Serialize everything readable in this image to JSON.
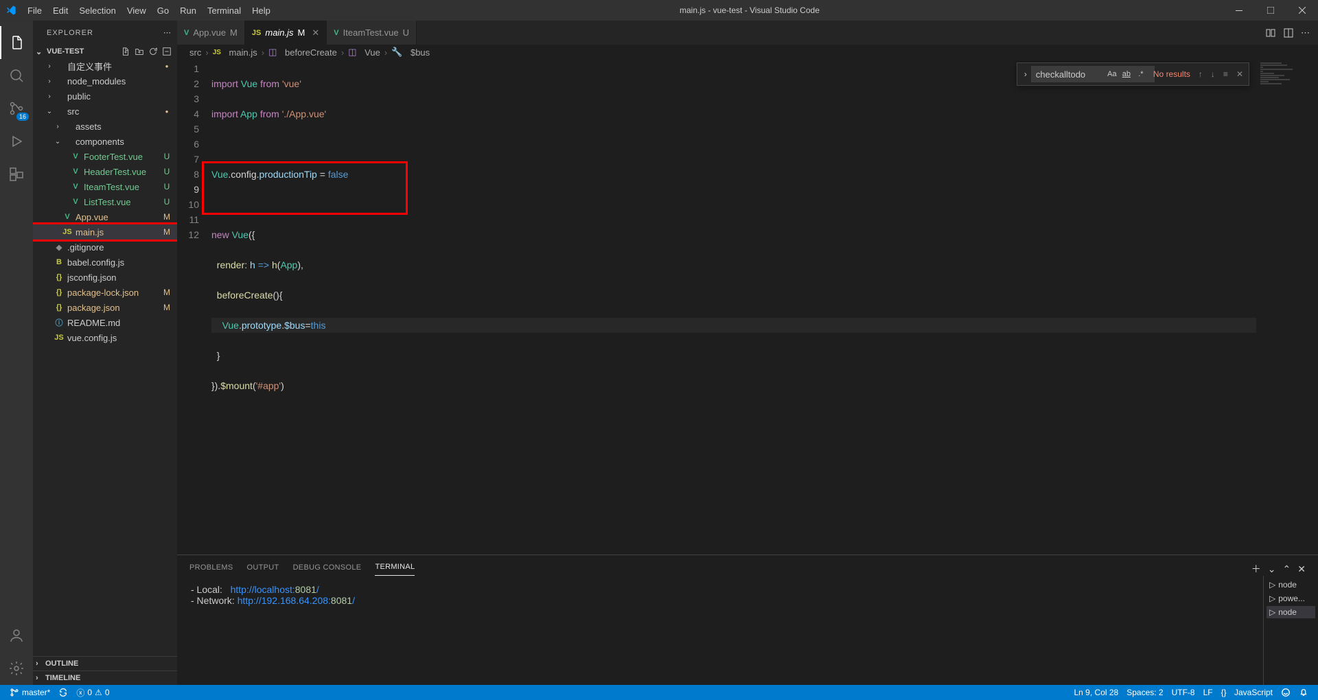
{
  "window": {
    "title": "main.js - vue-test - Visual Studio Code"
  },
  "menu": [
    "File",
    "Edit",
    "Selection",
    "View",
    "Go",
    "Run",
    "Terminal",
    "Help"
  ],
  "activitybar": {
    "badge": "16"
  },
  "sidebar": {
    "title": "EXPLORER",
    "folder": "VUE-TEST",
    "outline": "OUTLINE",
    "timeline": "TIMELINE"
  },
  "tree": [
    {
      "name": "自定义事件",
      "type": "folder",
      "indent": 1,
      "open": false,
      "status": "",
      "dot": true
    },
    {
      "name": "node_modules",
      "type": "folder",
      "indent": 1,
      "open": false
    },
    {
      "name": "public",
      "type": "folder",
      "indent": 1,
      "open": false
    },
    {
      "name": "src",
      "type": "folder",
      "indent": 1,
      "open": true,
      "status": "",
      "dot": true
    },
    {
      "name": "assets",
      "type": "folder",
      "indent": 2,
      "open": false
    },
    {
      "name": "components",
      "type": "folder",
      "indent": 2,
      "open": true
    },
    {
      "name": "FooterTest.vue",
      "type": "file",
      "icon": "V",
      "iconColor": "#41b883",
      "indent": 3,
      "status": "U",
      "statusClass": "U",
      "class": "untracked"
    },
    {
      "name": "HeaderTest.vue",
      "type": "file",
      "icon": "V",
      "iconColor": "#41b883",
      "indent": 3,
      "status": "U",
      "statusClass": "U",
      "class": "untracked"
    },
    {
      "name": "IteamTest.vue",
      "type": "file",
      "icon": "V",
      "iconColor": "#41b883",
      "indent": 3,
      "status": "U",
      "statusClass": "U",
      "class": "untracked"
    },
    {
      "name": "ListTest.vue",
      "type": "file",
      "icon": "V",
      "iconColor": "#41b883",
      "indent": 3,
      "status": "U",
      "statusClass": "U",
      "class": "untracked"
    },
    {
      "name": "App.vue",
      "type": "file",
      "icon": "V",
      "iconColor": "#41b883",
      "indent": 2,
      "status": "M",
      "statusClass": "M",
      "class": "modified"
    },
    {
      "name": "main.js",
      "type": "file",
      "icon": "JS",
      "iconColor": "#cbcb41",
      "indent": 2,
      "status": "M",
      "statusClass": "M",
      "class": "modified selected red-box"
    },
    {
      "name": ".gitignore",
      "type": "file",
      "icon": "◆",
      "iconColor": "#8d8d8d",
      "indent": 1
    },
    {
      "name": "babel.config.js",
      "type": "file",
      "icon": "B",
      "iconColor": "#cbcb41",
      "indent": 1
    },
    {
      "name": "jsconfig.json",
      "type": "file",
      "icon": "{}",
      "iconColor": "#cbcb41",
      "indent": 1
    },
    {
      "name": "package-lock.json",
      "type": "file",
      "icon": "{}",
      "iconColor": "#cbcb41",
      "indent": 1,
      "status": "M",
      "statusClass": "M",
      "class": "modified"
    },
    {
      "name": "package.json",
      "type": "file",
      "icon": "{}",
      "iconColor": "#cbcb41",
      "indent": 1,
      "status": "M",
      "statusClass": "M",
      "class": "modified"
    },
    {
      "name": "README.md",
      "type": "file",
      "icon": "ⓘ",
      "iconColor": "#519aba",
      "indent": 1
    },
    {
      "name": "vue.config.js",
      "type": "file",
      "icon": "JS",
      "iconColor": "#cbcb41",
      "indent": 1
    }
  ],
  "tabs": [
    {
      "name": "App.vue",
      "icon": "V",
      "iconColor": "#41b883",
      "status": "M",
      "statusClass": "M",
      "active": false
    },
    {
      "name": "main.js",
      "icon": "JS",
      "iconColor": "#cbcb41",
      "status": "M",
      "statusClass": "M",
      "active": true,
      "closeable": true,
      "italic": true
    },
    {
      "name": "IteamTest.vue",
      "icon": "V",
      "iconColor": "#41b883",
      "status": "U",
      "statusClass": "U",
      "active": false
    }
  ],
  "breadcrumbs": [
    {
      "label": "src"
    },
    {
      "icon": "JS",
      "label": "main.js"
    },
    {
      "icon": "cube",
      "label": "beforeCreate"
    },
    {
      "icon": "cube",
      "label": "Vue"
    },
    {
      "icon": "wrench",
      "label": "$bus"
    }
  ],
  "find": {
    "value": "checkalltodo",
    "result": "No results"
  },
  "code": {
    "lines": [
      1,
      2,
      3,
      4,
      5,
      6,
      7,
      8,
      9,
      10,
      11,
      12
    ]
  },
  "code_text": {
    "l1_import": "import",
    "l1_vue": "Vue",
    "l1_from": "from",
    "l1_str": "'vue'",
    "l2_import": "import",
    "l2_app": "App",
    "l2_from": "from",
    "l2_str": "'./App.vue'",
    "l4_a": "Vue",
    "l4_b": ".config.",
    "l4_c": "productionTip",
    "l4_eq": " = ",
    "l4_false": "false",
    "l6_new": "new",
    "l6_vue": "Vue",
    "l6_open": "({",
    "l7_render": "render",
    "l7_arrow": ": ",
    "l7_h1": "h",
    "l7_a2": " => ",
    "l7_h2": "h",
    "l7_p": "(",
    "l7_app": "App",
    "l7_close": "),",
    "l8_name": "beforeCreate",
    "l8_p": "(){",
    "l9_vue": "Vue",
    "l9_dot1": ".",
    "l9_proto": "prototype",
    "l9_dot2": ".",
    "l9_bus": "$bus",
    "l9_eq": "=",
    "l9_this": "this",
    "l10_close": "}",
    "l11_a": "}).",
    "l11_mount": "$mount",
    "l11_p": "(",
    "l11_str": "'#app'",
    "l11_cp": ")"
  },
  "panel": {
    "tabs": [
      "PROBLEMS",
      "OUTPUT",
      "DEBUG CONSOLE",
      "TERMINAL"
    ],
    "active": 3,
    "terminals": [
      "node",
      "powe...",
      "node"
    ],
    "activeTerminal": 2
  },
  "terminal": {
    "local_label": "- Local:   ",
    "network_label": "- Network: ",
    "local_host": "http://localhost:",
    "local_port": "8081",
    "local_slash": "/",
    "network_host": "http://192.168.64.208:",
    "network_port": "8081",
    "network_slash": "/"
  },
  "statusbar": {
    "branch": "master*",
    "errors": "0",
    "warnings": "0",
    "lncol": "Ln 9, Col 28",
    "spaces": "Spaces: 2",
    "encoding": "UTF-8",
    "eol": "LF",
    "lang": "JavaScript",
    "langicon": "{}"
  }
}
